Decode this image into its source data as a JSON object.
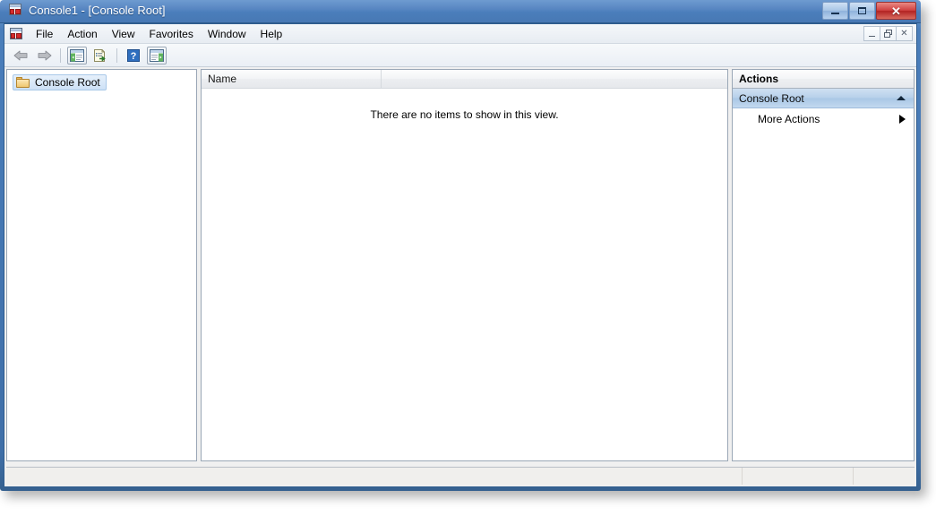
{
  "window": {
    "title": "Console1 - [Console Root]",
    "app_icon": "mmc-icon",
    "controls": {
      "minimize": "minimize-icon",
      "maximize": "maximize-icon",
      "close": "✕"
    }
  },
  "mdi_controls": {
    "minimize": "minimize-icon",
    "restore": "restore-icon",
    "close": "✕"
  },
  "menubar": {
    "icon": "mmc-icon",
    "items": [
      {
        "label": "File"
      },
      {
        "label": "Action"
      },
      {
        "label": "View"
      },
      {
        "label": "Favorites"
      },
      {
        "label": "Window"
      },
      {
        "label": "Help"
      }
    ]
  },
  "toolbar": {
    "buttons": [
      {
        "name": "back-arrow-icon",
        "tooltip": "Back"
      },
      {
        "name": "forward-arrow-icon",
        "tooltip": "Forward"
      },
      {
        "name": "show-hide-console-tree-icon",
        "tooltip": "Show/Hide Console Tree"
      },
      {
        "name": "export-list-icon",
        "tooltip": "Export List"
      },
      {
        "name": "help-icon",
        "tooltip": "Help"
      },
      {
        "name": "show-hide-action-pane-icon",
        "tooltip": "Show/Hide Action Pane"
      }
    ]
  },
  "tree": {
    "root_label": "Console Root",
    "root_icon": "folder-icon",
    "selected": "Console Root"
  },
  "list": {
    "columns": [
      {
        "label": "Name"
      },
      {
        "label": ""
      }
    ],
    "rows": [],
    "empty_message": "There are no items to show in this view."
  },
  "actions": {
    "header": "Actions",
    "group": {
      "label": "Console Root",
      "collapse_icon": "chevron-up-icon"
    },
    "items": [
      {
        "label": "More Actions",
        "submenu_icon": "triangle-right-icon"
      }
    ]
  },
  "statusbar": {
    "panels": [
      "",
      "",
      ""
    ]
  },
  "colors": {
    "frame_blue": "#4a7ebb",
    "close_red": "#b22222",
    "selection_blue": "#b6d0ea",
    "folder_gold": "#f0c871"
  }
}
